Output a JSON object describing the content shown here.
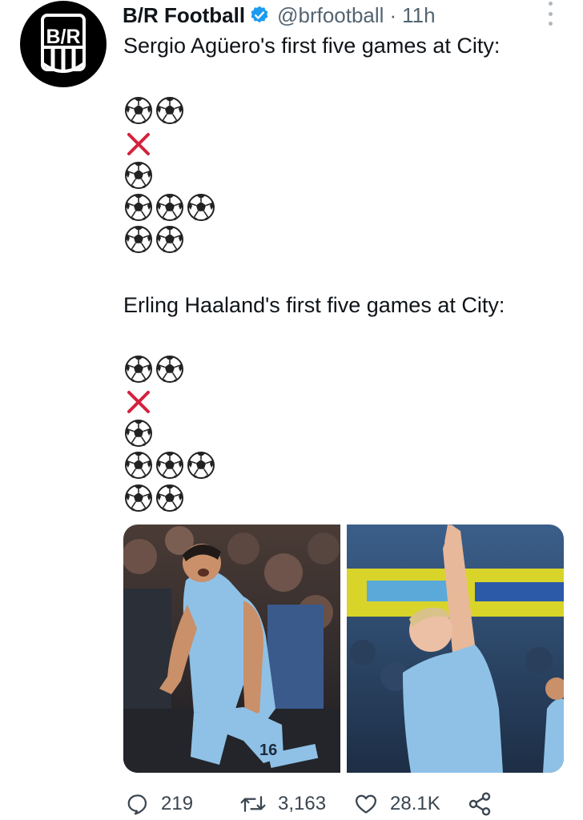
{
  "account": {
    "display_name": "B/R Football",
    "handle": "@brfootball",
    "separator": "·",
    "time": "11h",
    "avatar_text": "B/R"
  },
  "tweet": {
    "line1": "Sergio Agüero's first five games at City:",
    "line2": "Erling Haaland's first five games at City:",
    "aguero_games": [
      "goal-goal",
      "miss",
      "goal",
      "goal-goal-goal",
      "goal-goal"
    ],
    "haaland_games": [
      "goal-goal",
      "miss",
      "goal",
      "goal-goal-goal",
      "goal-goal"
    ]
  },
  "media": {
    "left": {
      "subject": "aguero-celebration",
      "shirt_number": "16"
    },
    "right": {
      "subject": "haaland-celebration"
    }
  },
  "actions": {
    "replies": "219",
    "retweets": "3,163",
    "likes": "28.1K"
  },
  "colors": {
    "verified": "#1d9bf0",
    "miss_x": "#d4213d",
    "city_blue": "#8fc1e6",
    "muted": "#536471"
  }
}
